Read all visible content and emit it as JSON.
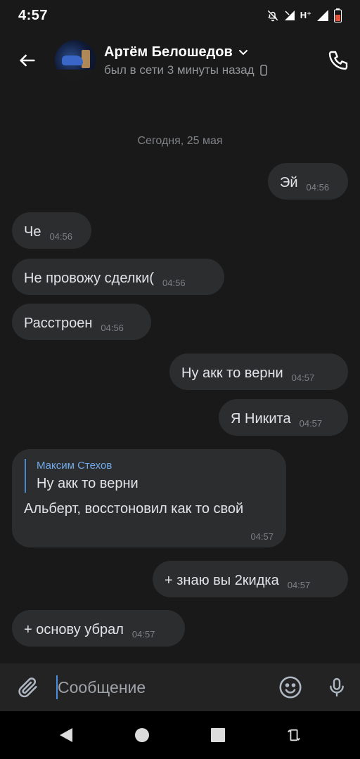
{
  "status": {
    "time": "4:57",
    "network": "H⁺"
  },
  "header": {
    "name": "Артём Белошедов",
    "status": "был в сети 3 минуты назад"
  },
  "date_separator": "Сегодня, 25 мая",
  "messages": [
    {
      "text": "Эй",
      "time": "04:56"
    },
    {
      "text": "Че",
      "time": "04:56"
    },
    {
      "text": "Не провожу сделки(",
      "time": "04:56"
    },
    {
      "text": "Расстроен",
      "time": "04:56"
    },
    {
      "text": "Ну акк то верни",
      "time": "04:57"
    },
    {
      "text": "Я Никита",
      "time": "04:57"
    },
    {
      "reply_author": "Максим Стехов",
      "reply_text": "Ну акк то верни",
      "text": "Альберт, восстоновил как то свой",
      "time": "04:57"
    },
    {
      "text": "+ знаю вы 2кидка",
      "time": "04:57"
    },
    {
      "text": "+ основу убрал",
      "time": "04:57"
    }
  ],
  "composer": {
    "placeholder": "Сообщение"
  },
  "colors": {
    "background": "#19191a",
    "bubble": "#2c2d2e",
    "accent": "#71aaeb"
  },
  "icons": [
    "back-arrow-icon",
    "chevron-down-icon",
    "mobile-device-icon",
    "phone-icon",
    "paperclip-icon",
    "emoji-icon",
    "microphone-icon",
    "nav-back-icon",
    "nav-home-icon",
    "nav-recents-icon",
    "rotate-icon"
  ]
}
